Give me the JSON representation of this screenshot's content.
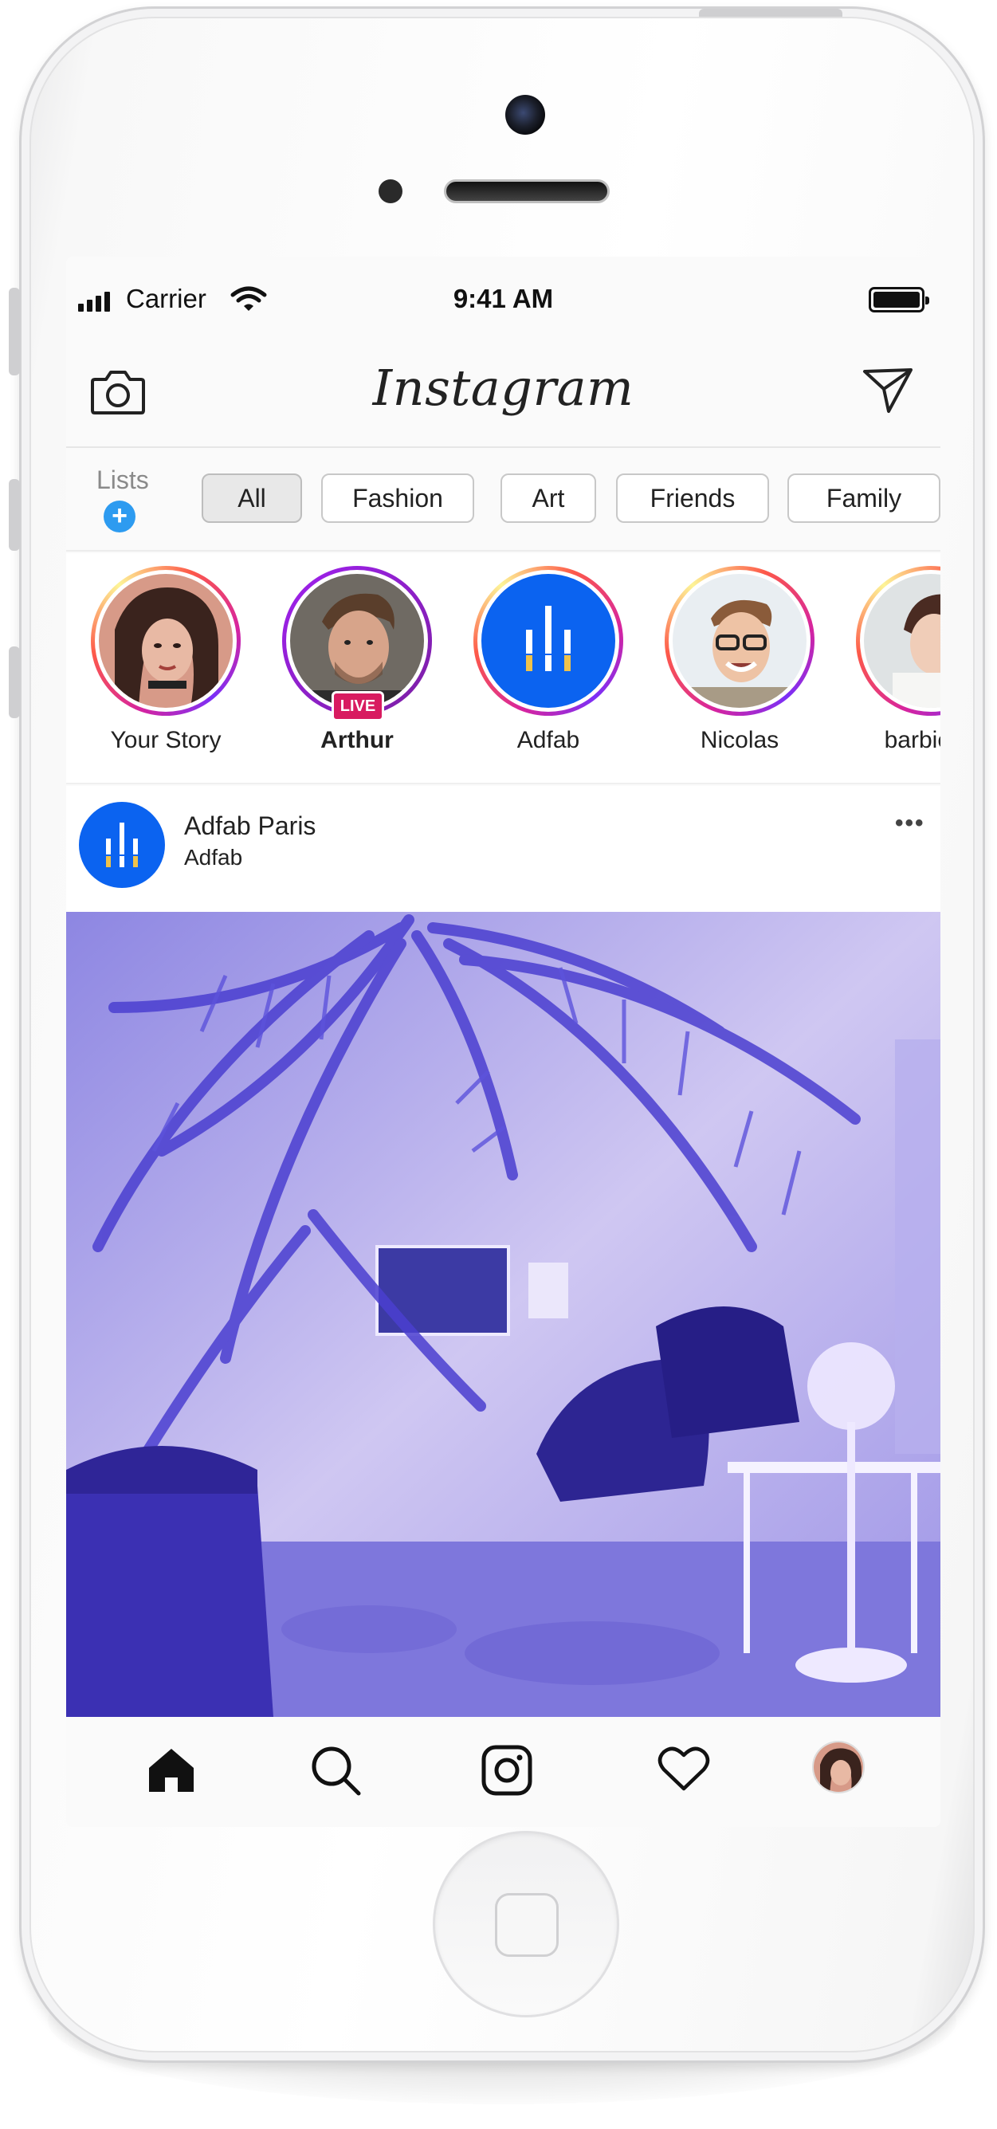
{
  "status_bar": {
    "carrier": "Carrier",
    "time": "9:41 AM"
  },
  "header": {
    "logo": "Instagram",
    "camera_icon": "camera-icon",
    "direct_icon": "paper-plane-icon"
  },
  "lists": {
    "label": "Lists",
    "add_icon": "plus-icon",
    "chips": [
      "All",
      "Fashion",
      "Art",
      "Friends",
      "Family"
    ],
    "selected": "All"
  },
  "stories": [
    {
      "name": "Your Story",
      "live": false
    },
    {
      "name": "Arthur",
      "live": true,
      "badge": "LIVE"
    },
    {
      "name": "Adfab",
      "live": false
    },
    {
      "name": "Nicolas",
      "live": false
    },
    {
      "name": "barbie_g",
      "live": false
    }
  ],
  "post": {
    "author": "Adfab Paris",
    "subtitle": "Adfab",
    "more": "•••"
  },
  "tab_bar": [
    "home-icon",
    "search-icon",
    "camera-icon",
    "heart-icon",
    "profile-avatar"
  ],
  "colors": {
    "accent_blue": "#2d9bf0",
    "live_badge": "#d81b60",
    "adfab_blue": "#0b63f0",
    "photo_tint": "#6f66e6"
  }
}
